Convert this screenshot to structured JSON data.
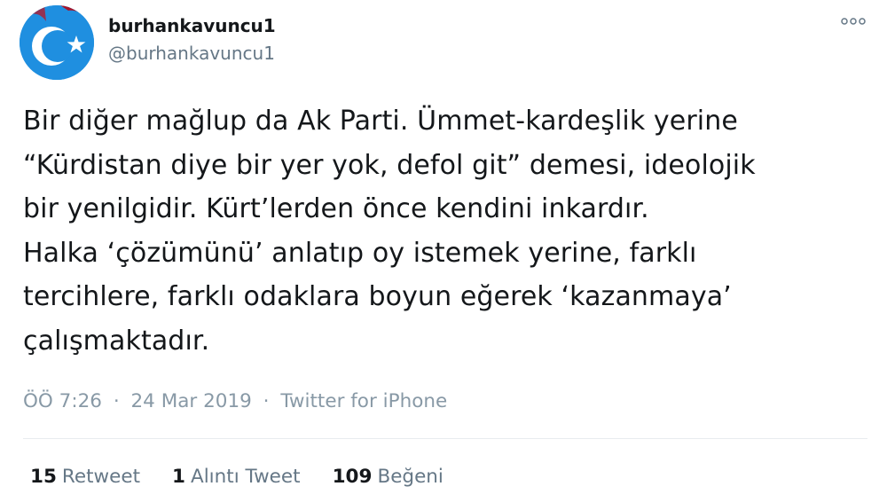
{
  "tweet": {
    "display_name": "burhankavuncu1",
    "handle": "@burhankavuncu1",
    "more_icon": "more-options-icon",
    "lines": [
      "Bir diğer mağlup da Ak Parti. Ümmet-kardeşlik yerine",
      "“Kürdistan diye bir yer yok, defol git” demesi, ideolojik",
      "bir yenilgidir. Kürt’lerden önce kendini inkardır.",
      "Halka ‘çözümünü’ anlatıp oy istemek yerine, farklı",
      "tercihlere, farklı odaklara boyun eğerek ‘kazanmaya’",
      "çalışmaktadır."
    ],
    "time": "ÖÖ 7:26",
    "date": "24 Mar 2019",
    "source": "Twitter for iPhone",
    "separator": "·"
  },
  "stats": {
    "retweets_count": "15",
    "retweets_label": "Retweet",
    "quotes_count": "1",
    "quotes_label": "Alıntı Tweet",
    "likes_count": "109",
    "likes_label": "Beğeni"
  },
  "colors": {
    "avatar_bg": "#1f8fe0",
    "text_primary": "#14171a",
    "text_secondary": "#657786",
    "text_meta": "#8899a6"
  }
}
